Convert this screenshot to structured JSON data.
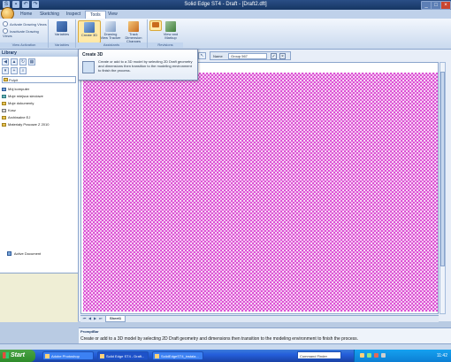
{
  "app": {
    "title": "Solid Edge ST4 - Draft - [Draft2.dft]"
  },
  "ribbon": {
    "tabs": [
      "Home",
      "Sketching",
      "Inspect",
      "Tools",
      "View"
    ],
    "active_tab": "Tools",
    "groups": {
      "drawing_views": {
        "label": "View Activation",
        "radio1": "Activate Drawing Views",
        "radio2": "Inactivate Drawing Views"
      },
      "variables": {
        "label": "Variables",
        "button": "Variables"
      },
      "assistants": {
        "label": "Assistants",
        "create3d": "Create 3D",
        "viewtracker": "Drawing View Tracker",
        "trackdim": "Track Dimension Changes"
      },
      "revisions": {
        "label": "Revisions",
        "viewmarkup": "View and Markup"
      }
    }
  },
  "library": {
    "title": "Library",
    "path": "Pulpit",
    "items": [
      "Mój komputer",
      "Moje miejsca sieciowe",
      "Moje dokumenty",
      "Kosz",
      "Archiwalne EJ",
      "Materiały Pracowe Z 2010"
    ],
    "active_document": "Active Document"
  },
  "namebar": {
    "label": "Name",
    "value": "Group 567"
  },
  "tooltip": {
    "title": "Create 3D",
    "body": "Create or add to a 3D model by selecting 2D Draft geometry and dimensions then transition to the modeling environment to finish the process."
  },
  "sheet": {
    "tab": "Sheet1"
  },
  "prompt": {
    "title": "PromptBar",
    "text": "Create or add to a 3D model by selecting 2D Draft geometry and dimensions then transition to the modeling environment to finish the process."
  },
  "taskbar": {
    "start": "Start",
    "tasks": [
      "Adobe Photoshop",
      "Solid Edge ST4 - Draft...",
      "SolidEdgeST4_instala..."
    ],
    "command_finder": "Command Finder",
    "clock": "11:42"
  },
  "colors": {
    "grid_magenta": "#d21cc8",
    "accent_blue": "#1941a5"
  }
}
